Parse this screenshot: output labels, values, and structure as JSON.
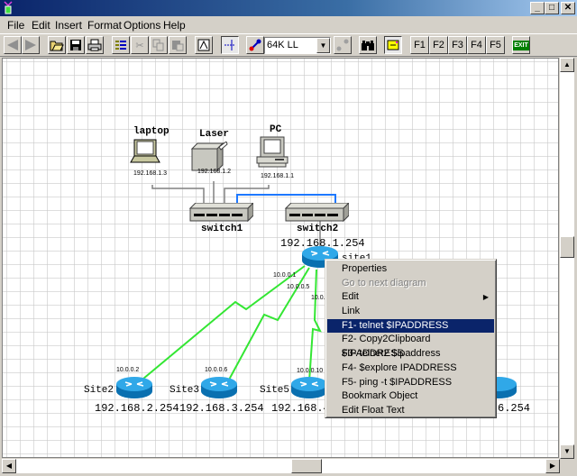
{
  "window": {
    "title": "",
    "controls": [
      "minimize",
      "maximize",
      "close"
    ]
  },
  "menu": [
    "File",
    "Edit",
    "Insert",
    "Format",
    "Options",
    "Help"
  ],
  "toolbar": {
    "buttons": [
      "back",
      "forward",
      "open",
      "save",
      "print",
      "properties",
      "cut",
      "copy",
      "paste",
      "text",
      "connect-points",
      "link"
    ],
    "link_speed": "64K LL",
    "function_keys": [
      "F1",
      "F2",
      "F3",
      "F4",
      "F5"
    ],
    "exit_label": "EXIT"
  },
  "diagram": {
    "devices": [
      {
        "name": "laptop",
        "ip": "192.168.1.3"
      },
      {
        "name": "Laser",
        "ip": "192.168.1.2"
      },
      {
        "name": "PC",
        "ip": "192.168.1.1"
      },
      {
        "name": "switch1"
      },
      {
        "name": "switch2"
      }
    ],
    "routers": [
      {
        "name": "site1",
        "lan_ip": "192.168.1.254"
      },
      {
        "name": "Site2",
        "lan_ip": "192.168.2.254",
        "wan_ip": "10.0.0.2"
      },
      {
        "name": "Site3",
        "lan_ip": "192.168.3.254",
        "wan_ip": "10.0.0.6"
      },
      {
        "name": "Site5",
        "lan_ip": "192.168.4",
        "wan_ip": "10.0.0.10"
      },
      {
        "name": "",
        "lan_ip": "6.254"
      }
    ],
    "site1_link_ips": [
      "10.0.0.1",
      "10.0.0.5",
      "10.0."
    ]
  },
  "context_menu": {
    "items": [
      {
        "label": "Properties",
        "state": "normal"
      },
      {
        "label": "Go to next diagram",
        "state": "disabled"
      },
      {
        "label": "Edit",
        "state": "submenu"
      },
      {
        "label": "Link",
        "state": "normal"
      },
      {
        "label": "F1- telnet $IPADDRESS",
        "state": "selected"
      },
      {
        "label": "F2- Copy2Clipboard $IPADDRESS",
        "state": "normal"
      },
      {
        "label": "F3- telnet2 $ipaddress",
        "state": "normal"
      },
      {
        "label": "F4- $explore IPADDRESS",
        "state": "normal"
      },
      {
        "label": "F5- ping -t $IPADDRESS",
        "state": "normal"
      },
      {
        "label": "Bookmark Object",
        "state": "normal"
      },
      {
        "label": "Edit Float Text",
        "state": "normal"
      }
    ]
  },
  "colors": {
    "title_bar": "#0a246a",
    "wan_link": "#33e633",
    "lan_link_blue": "#1e78ff",
    "router": "#1e90c8",
    "menu_highlight": "#0a246a"
  }
}
